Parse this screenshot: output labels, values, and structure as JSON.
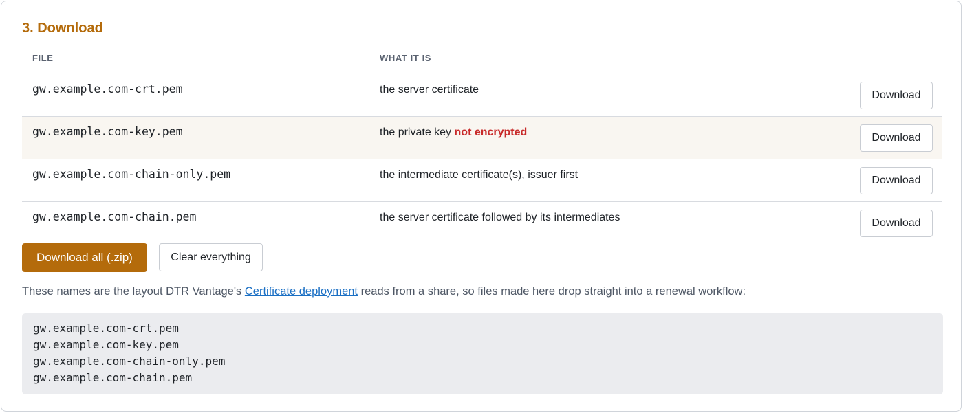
{
  "section": {
    "title": "3. Download"
  },
  "table": {
    "headers": {
      "file": "FILE",
      "what": "WHAT IT IS"
    },
    "rows": [
      {
        "file": "gw.example.com-crt.pem",
        "desc": "the server certificate",
        "warn": "",
        "button": "Download"
      },
      {
        "file": "gw.example.com-key.pem",
        "desc": "the private key",
        "warn": "not encrypted",
        "button": "Download"
      },
      {
        "file": "gw.example.com-chain-only.pem",
        "desc": "the intermediate certificate(s), issuer first",
        "warn": "",
        "button": "Download"
      },
      {
        "file": "gw.example.com-chain.pem",
        "desc": "the server certificate followed by its intermediates",
        "warn": "",
        "button": "Download"
      }
    ]
  },
  "actions": {
    "download_all": "Download all (.zip)",
    "clear": "Clear everything"
  },
  "note": {
    "before": "These names are the layout DTR Vantage's ",
    "link": "Certificate deployment",
    "after": " reads from a share, so files made here drop straight into a renewal workflow:"
  },
  "code_lines": [
    "gw.example.com-crt.pem",
    "gw.example.com-key.pem",
    "gw.example.com-chain-only.pem",
    "gw.example.com-chain.pem"
  ],
  "colors": {
    "accent": "#b46b0b",
    "warning": "#c82a2a",
    "link": "#1a6fc4",
    "code_bg": "#ebecef",
    "row_highlight": "#f9f6f1"
  }
}
